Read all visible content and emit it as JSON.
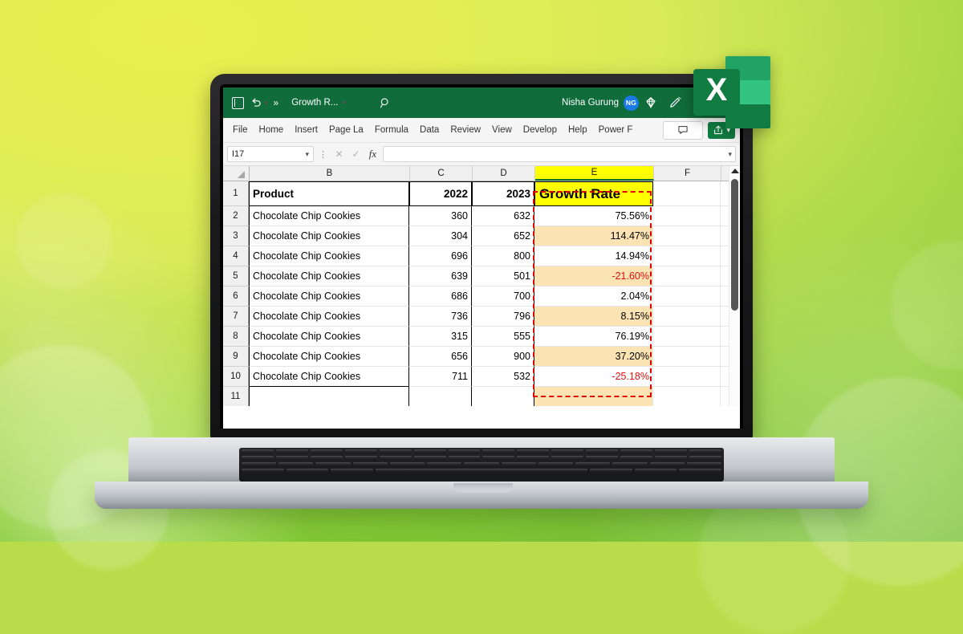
{
  "app": {
    "titlebar": {
      "app_icon": "excel-app-icon",
      "undo_icon": "undo-icon",
      "undo_dropdown_icon": "chevron-down-icon",
      "more_commands_icon": "double-chevron-right-icon",
      "document_name": "Growth R...",
      "document_dropdown_icon": "chevron-down-icon",
      "search_icon": "search-icon",
      "user_name": "Nisha Gurung",
      "user_initials": "NG",
      "diamond_icon": "diamond-icon",
      "designer_icon": "pen-designer-icon",
      "minimize_icon": "minimize-icon",
      "maximize_icon": "maximize-icon"
    },
    "ribbon": {
      "tabs": [
        {
          "label": "File"
        },
        {
          "label": "Home"
        },
        {
          "label": "Insert"
        },
        {
          "label": "Page La"
        },
        {
          "label": "Formula"
        },
        {
          "label": "Data"
        },
        {
          "label": "Review"
        },
        {
          "label": "View"
        },
        {
          "label": "Develop"
        },
        {
          "label": "Help"
        },
        {
          "label": "Power F"
        }
      ],
      "comments_icon": "comment-icon",
      "share_icon": "share-icon",
      "share_dropdown_icon": "chevron-down-icon"
    },
    "formula_bar": {
      "name_box_value": "I17",
      "name_box_dropdown_icon": "chevron-down-icon",
      "more_icon": "vertical-ellipsis-icon",
      "cancel_icon": "cancel-x-icon",
      "enter_icon": "confirm-check-icon",
      "function_icon": "fx-insert-function-icon",
      "formula_value": "",
      "expand_icon": "chevron-down-icon"
    },
    "grid": {
      "select_all_icon": "select-all-corner-icon",
      "column_headers": [
        "B",
        "C",
        "D",
        "E",
        "F"
      ],
      "selected_column": "E",
      "row_numbers": [
        "1",
        "2",
        "3",
        "4",
        "5",
        "6",
        "7",
        "8",
        "9",
        "10"
      ],
      "partial_row_number": "11",
      "scrollbar_up_icon": "scroll-up-arrow-icon"
    }
  },
  "sheet_data": {
    "type": "table",
    "headers": {
      "B": "Product",
      "C": "2022",
      "D": "2023",
      "E": "Growth Rate"
    },
    "rows": [
      {
        "row": "2",
        "product": "Chocolate Chip Cookies",
        "y2022": "360",
        "y2023": "632",
        "growth": "75.56%",
        "negative": false,
        "shaded": false
      },
      {
        "row": "3",
        "product": "Chocolate Chip Cookies",
        "y2022": "304",
        "y2023": "652",
        "growth": "114.47%",
        "negative": false,
        "shaded": true
      },
      {
        "row": "4",
        "product": "Chocolate Chip Cookies",
        "y2022": "696",
        "y2023": "800",
        "growth": "14.94%",
        "negative": false,
        "shaded": false
      },
      {
        "row": "5",
        "product": "Chocolate Chip Cookies",
        "y2022": "639",
        "y2023": "501",
        "growth": "-21.60%",
        "negative": true,
        "shaded": true
      },
      {
        "row": "6",
        "product": "Chocolate Chip Cookies",
        "y2022": "686",
        "y2023": "700",
        "growth": "2.04%",
        "negative": false,
        "shaded": false
      },
      {
        "row": "7",
        "product": "Chocolate Chip Cookies",
        "y2022": "736",
        "y2023": "796",
        "growth": "8.15%",
        "negative": false,
        "shaded": true
      },
      {
        "row": "8",
        "product": "Chocolate Chip Cookies",
        "y2022": "315",
        "y2023": "555",
        "growth": "76.19%",
        "negative": false,
        "shaded": false
      },
      {
        "row": "9",
        "product": "Chocolate Chip Cookies",
        "y2022": "656",
        "y2023": "900",
        "growth": "37.20%",
        "negative": false,
        "shaded": true
      },
      {
        "row": "10",
        "product": "Chocolate Chip Cookies",
        "y2022": "711",
        "y2023": "532",
        "growth": "-25.18%",
        "negative": true,
        "shaded": false
      }
    ]
  },
  "overlay": {
    "excel_logo_icon": "excel-logo-icon",
    "excel_logo_letter": "X"
  },
  "colors": {
    "titlebar_green": "#106c3a",
    "share_green": "#107c41",
    "header_highlight_yellow": "#ffff00",
    "alt_row_fill": "#fce3b4",
    "negative_text_red": "#e01010",
    "marching_ants_red": "#e00000",
    "avatar_blue": "#1a7ae8"
  }
}
